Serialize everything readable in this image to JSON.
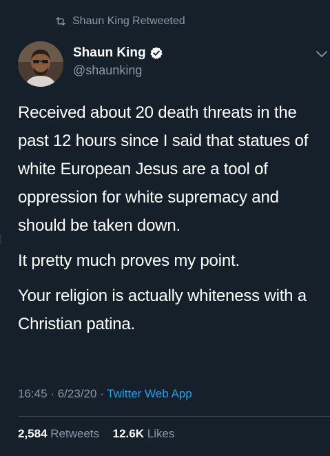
{
  "retweet_header": {
    "icon": "retweet-icon",
    "text": "Shaun King Retweeted"
  },
  "author": {
    "display_name": "Shaun King",
    "verified": true,
    "verified_color": "#1da1f2",
    "handle": "@shaunking",
    "avatar_icon": "avatar-photo"
  },
  "tweet": {
    "paragraphs": [
      "Received about 20 death threats in the past 12 hours since I said that statues of white European Jesus are a tool of oppression for white supremacy and should be taken down.",
      "It pretty much proves my point.",
      "Your religion is actually whiteness with a Christian patina."
    ]
  },
  "meta": {
    "time": "16:45",
    "separator": "·",
    "date": "6/23/20",
    "source": "Twitter Web App",
    "source_color": "#1da1f2"
  },
  "stats": {
    "retweets_count": "2,584",
    "retweets_label": "Retweets",
    "likes_count": "12.6K",
    "likes_label": "Likes"
  },
  "theme": {
    "background": "#15202b",
    "secondary_text": "#8899a6",
    "divider": "#38444d"
  }
}
